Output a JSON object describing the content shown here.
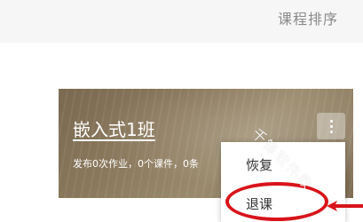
{
  "header": {
    "sort_label": "课程排序"
  },
  "course_card": {
    "title": "嵌入式1班",
    "stats": "发布0次作业，0个课件，0条"
  },
  "dropdown_menu": {
    "items": [
      {
        "label": "恢复"
      },
      {
        "label": "退课"
      }
    ]
  },
  "watermark": {
    "text": "千锋软件教"
  },
  "annotation": {
    "color": "#d8141a"
  },
  "icons": {
    "more": "vertical-ellipsis-icon",
    "arrow": "red-arrow-icon"
  }
}
